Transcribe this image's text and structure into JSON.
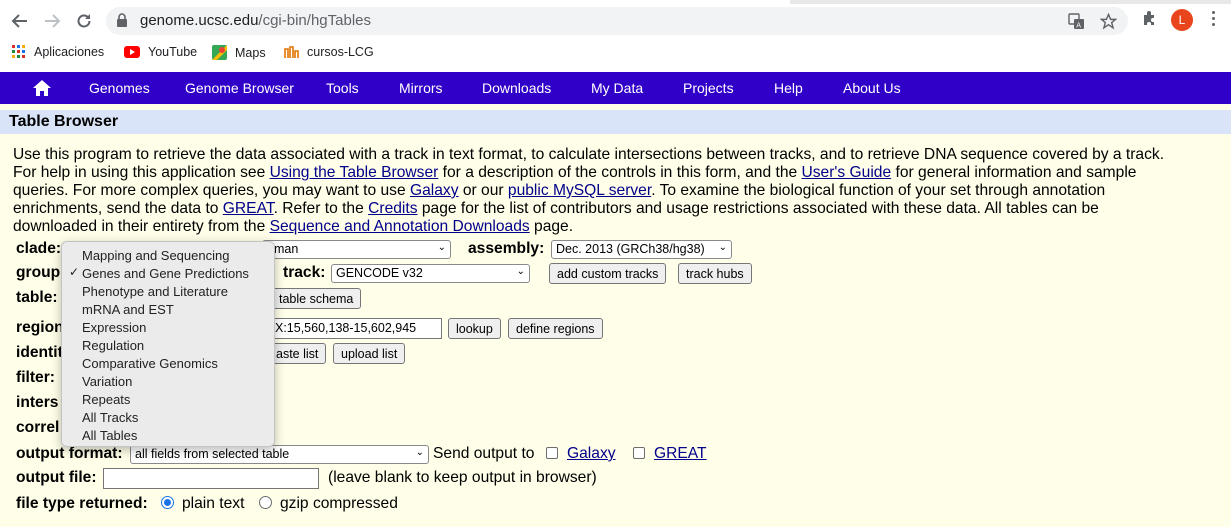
{
  "browser": {
    "url_host": "genome.ucsc.edu",
    "url_path": "/cgi-bin/hgTables",
    "avatar_letter": "L",
    "bookmarks": [
      "Aplicaciones",
      "YouTube",
      "Maps",
      "cursos-LCG"
    ]
  },
  "navbar": {
    "items": [
      "Genomes",
      "Genome Browser",
      "Tools",
      "Mirrors",
      "Downloads",
      "My Data",
      "Projects",
      "Help",
      "About Us"
    ]
  },
  "page": {
    "title": "Table Browser"
  },
  "intro": {
    "l1": "Use this program to retrieve the data associated with a track in text format, to calculate intersections between tracks, and to retrieve DNA sequence covered by a track.",
    "l2_a": "For help in using this application see ",
    "l2_link1": "Using the Table Browser",
    "l2_b": " for a description of the controls in this form, and the ",
    "l2_link2": "User's Guide",
    "l2_c": " for general information and sample",
    "l3_a": "queries. For more complex queries, you may want to use ",
    "l3_link1": "Galaxy",
    "l3_b": " or our ",
    "l3_link2": "public MySQL server",
    "l3_c": ". To examine the biological function of your set through annotation",
    "l4_a": "enrichments, send the data to ",
    "l4_link1": "GREAT",
    "l4_b": ". Refer to the ",
    "l4_link2": "Credits",
    "l4_c": " page for the list of contributors and usage restrictions associated with these data. All tables can be",
    "l5_a": "downloaded in their entirety from the ",
    "l5_link1": "Sequence and Annotation Downloads",
    "l5_b": " page."
  },
  "form": {
    "clade_label": "clade:",
    "genome_value": "uman",
    "assembly_label": "assembly:",
    "assembly_value": "Dec. 2013 (GRCh38/hg38)",
    "group_label": "group",
    "track_label": "track:",
    "track_value": "GENCODE v32",
    "add_custom_tracks": "add custom tracks",
    "track_hubs": "track hubs",
    "table_label": "table:",
    "table_schema": "table schema",
    "region_label": "region",
    "position_value": "X:15,560,138-15,602,945",
    "lookup": "lookup",
    "define_regions": "define regions",
    "identifiers_label": "identit",
    "paste_list": "aste list",
    "upload_list": "upload list",
    "filter_label": "filter:",
    "intersection_label": "inters",
    "correlation_label": "correl",
    "output_format_label": "output format:",
    "output_format_value": "all fields from selected table",
    "send_output_to": "Send output to",
    "galaxy": "Galaxy",
    "great": "GREAT",
    "output_file_label": "output file:",
    "output_file_value": "",
    "output_file_hint": "(leave blank to keep output in browser)",
    "file_type_label": "file type returned:",
    "plain_text": "plain text",
    "gzip": "gzip compressed"
  },
  "group_menu": {
    "selected": "Genes and Gene Predictions",
    "options": [
      "Mapping and Sequencing",
      "Genes and Gene Predictions",
      "Phenotype and Literature",
      "mRNA and EST",
      "Expression",
      "Regulation",
      "Comparative Genomics",
      "Variation",
      "Repeats",
      "All Tracks",
      "All Tables"
    ]
  },
  "colors": {
    "navbar": "#3000c8",
    "title_bar": "#d9e4f8",
    "page_bg": "#fffee8",
    "link": "#00008b"
  }
}
